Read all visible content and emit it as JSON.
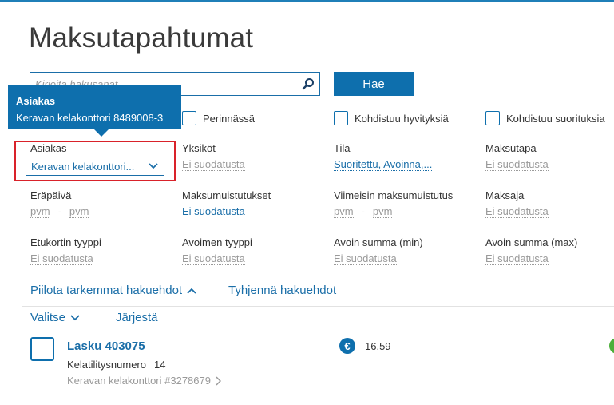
{
  "page": {
    "title": "Maksutapahtumat"
  },
  "search": {
    "placeholder": "Kirjoita hakusanat",
    "button_label": "Hae"
  },
  "checkboxes": {
    "perinnassa": "Perinnässä",
    "kohdistuu_hyvityksia": "Kohdistuu hyvityksiä",
    "kohdistuu_suorituksia": "Kohdistuu suorituksia"
  },
  "tooltip": {
    "title": "Asiakas",
    "body": "Keravan kelakonttori 8489008-3"
  },
  "filters": {
    "asiakas": {
      "label": "Asiakas",
      "value": "Keravan kelakonttori..."
    },
    "yksikot": {
      "label": "Yksiköt",
      "value": "Ei suodatusta"
    },
    "tila": {
      "label": "Tila",
      "value": "Suoritettu, Avoinna,..."
    },
    "maksutapa": {
      "label": "Maksutapa",
      "value": "Ei suodatusta"
    },
    "erapaiva": {
      "label": "Eräpäivä",
      "from": "pvm",
      "to": "pvm",
      "separator": "-"
    },
    "maksumuistutukset": {
      "label": "Maksumuistutukset",
      "value": "Ei suodatusta"
    },
    "viimeisin_maksumuistutus": {
      "label": "Viimeisin maksumuistutus",
      "from": "pvm",
      "to": "pvm",
      "separator": "-"
    },
    "maksaja": {
      "label": "Maksaja",
      "value": "Ei suodatusta"
    },
    "etukortin_tyyppi": {
      "label": "Etukortin tyyppi",
      "value": "Ei suodatusta"
    },
    "avoimen_tyyppi": {
      "label": "Avoimen tyyppi",
      "value": "Ei suodatusta"
    },
    "avoin_summa_min": {
      "label": "Avoin summa (min)",
      "value": "Ei suodatusta"
    },
    "avoin_summa_max": {
      "label": "Avoin summa (max)",
      "value": "Ei suodatusta"
    }
  },
  "actions": {
    "hide_filters": "Piilota tarkemmat hakuehdot",
    "clear_filters": "Tyhjennä hakuehdot",
    "select": "Valitse",
    "sort": "Järjestä"
  },
  "results": [
    {
      "title": "Lasku 403075",
      "meta_label": "Kelatilitysnumero",
      "meta_value": "14",
      "customer": "Keravan kelakonttori #3278679",
      "currency_symbol": "€",
      "amount": "16,59"
    }
  ],
  "colors": {
    "accent": "#0e6fad",
    "highlight": "#d9222a",
    "status_ok": "#4caf3a"
  }
}
